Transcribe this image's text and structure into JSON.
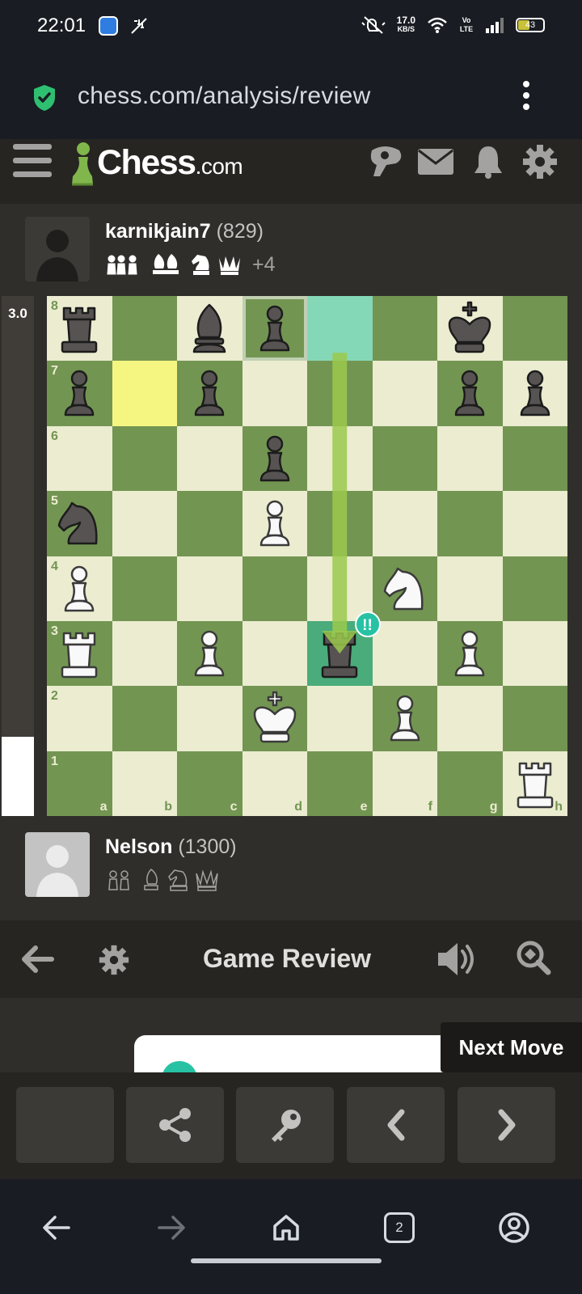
{
  "status_bar": {
    "time": "22:01",
    "net_speed": "17.0",
    "net_unit": "KB/S",
    "volte": "Vo LTE",
    "battery": "43",
    "icons": [
      "app-icon",
      "dnd-icon",
      "mute-icon",
      "wifi-icon",
      "signal-icon",
      "battery-icon"
    ]
  },
  "browser": {
    "url": "chess.com/analysis/review",
    "icons": [
      "shield-icon",
      "kebab-menu-icon"
    ]
  },
  "site_header": {
    "logo_word": "Chess",
    "logo_suffix": ".com",
    "icons": [
      "hamburger-icon",
      "message-bubble-icon",
      "mail-icon",
      "bell-icon",
      "settings-icon"
    ]
  },
  "top_player": {
    "name": "karnikjain7",
    "rating": "(829)",
    "material_advantage": "+4",
    "captured_pieces": [
      "pawn",
      "pawn",
      "pawn",
      "bishop",
      "bishop",
      "knight",
      "queen"
    ]
  },
  "bottom_player": {
    "name": "Nelson",
    "rating": "(1300)",
    "captured_pieces": [
      "pawn",
      "pawn",
      "bishop",
      "knight",
      "queen"
    ]
  },
  "eval": {
    "score": "3.0",
    "white_fraction": 0.153
  },
  "board": {
    "ranks": [
      "8",
      "7",
      "6",
      "5",
      "4",
      "3",
      "2",
      "1"
    ],
    "files": [
      "a",
      "b",
      "c",
      "d",
      "e",
      "f",
      "g",
      "h"
    ],
    "pieces": [
      {
        "square": "a8",
        "color": "b",
        "type": "r"
      },
      {
        "square": "c8",
        "color": "b",
        "type": "b"
      },
      {
        "square": "d8",
        "color": "b",
        "type": "p"
      },
      {
        "square": "g8",
        "color": "b",
        "type": "k"
      },
      {
        "square": "a7",
        "color": "b",
        "type": "p"
      },
      {
        "square": "c7",
        "color": "b",
        "type": "p"
      },
      {
        "square": "g7",
        "color": "b",
        "type": "p"
      },
      {
        "square": "h7",
        "color": "b",
        "type": "p"
      },
      {
        "square": "d6",
        "color": "b",
        "type": "p"
      },
      {
        "square": "a5",
        "color": "b",
        "type": "n"
      },
      {
        "square": "d5",
        "color": "w",
        "type": "p"
      },
      {
        "square": "a4",
        "color": "w",
        "type": "p"
      },
      {
        "square": "f4",
        "color": "w",
        "type": "n"
      },
      {
        "square": "a3",
        "color": "w",
        "type": "r"
      },
      {
        "square": "c3",
        "color": "w",
        "type": "p"
      },
      {
        "square": "e3",
        "color": "b",
        "type": "r"
      },
      {
        "square": "g3",
        "color": "w",
        "type": "p"
      },
      {
        "square": "d2",
        "color": "w",
        "type": "k"
      },
      {
        "square": "f2",
        "color": "w",
        "type": "p"
      },
      {
        "square": "h1",
        "color": "w",
        "type": "r"
      }
    ],
    "highlights": [
      {
        "square": "b7",
        "color": "#f5f682"
      },
      {
        "square": "e8",
        "color": "#85d8b7"
      },
      {
        "square": "e3",
        "color": "#4aab7b"
      }
    ],
    "outlined_square": "d8",
    "arrow": {
      "from": "e8",
      "to": "e3",
      "color": "#9bc94c"
    },
    "move_badge": {
      "square": "e3",
      "label": "!!",
      "color": "#26c2a3"
    }
  },
  "review": {
    "title": "Game Review",
    "tooltip": "Next Move",
    "icons": [
      "back-arrow-icon",
      "settings-icon",
      "speaker-icon",
      "zoom-analysis-icon"
    ]
  },
  "controls": {
    "icons": [
      "blank",
      "share-icon",
      "key-icon",
      "chevron-left-icon",
      "chevron-right-icon"
    ]
  },
  "navbar": {
    "tab_count": "2",
    "icons": [
      "back-icon",
      "forward-icon",
      "home-icon",
      "tabs-icon",
      "account-icon"
    ]
  }
}
